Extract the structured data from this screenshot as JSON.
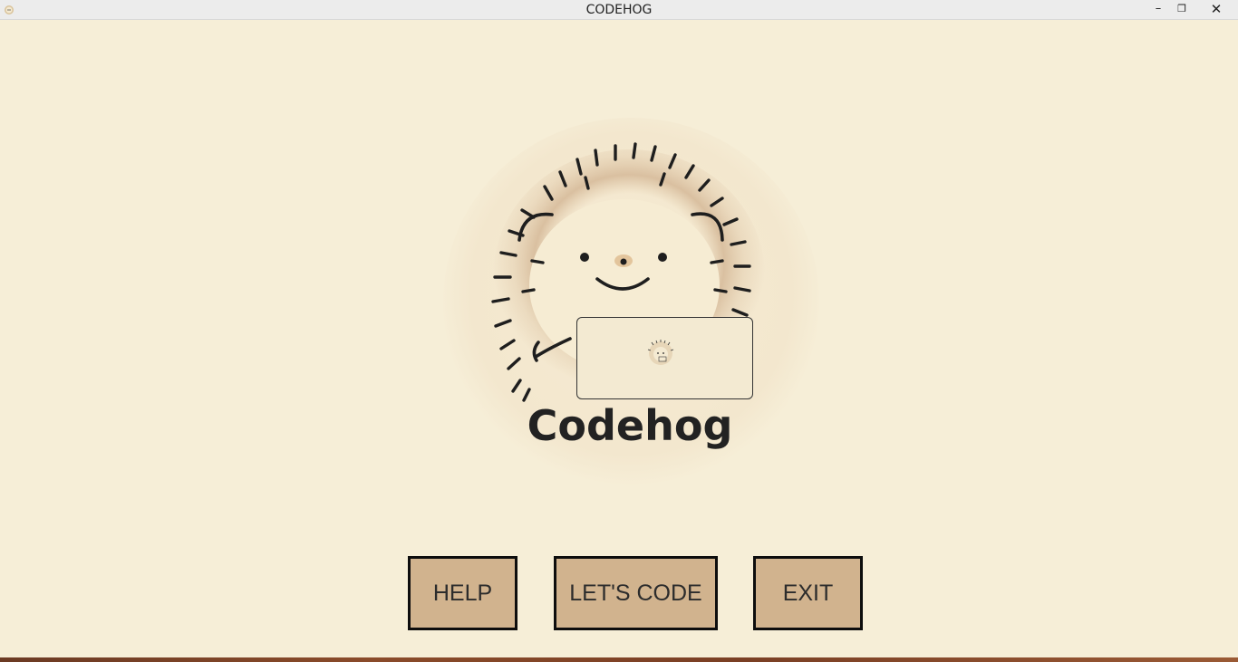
{
  "window": {
    "title": "CODEHOG",
    "icon": "hedgehog-app-icon",
    "controls": {
      "minimize": "–",
      "maximize": "❐",
      "close": "✕"
    }
  },
  "logo": {
    "image": "hedgehog-with-laptop-logo",
    "name": "Codehog"
  },
  "buttons": {
    "help": "HELP",
    "lets_code": "LET'S CODE",
    "exit": "EXIT"
  },
  "colors": {
    "background": "#f6eed7",
    "button_fill": "#d1b38e",
    "button_border": "#0d0d0d",
    "text": "#222222"
  }
}
